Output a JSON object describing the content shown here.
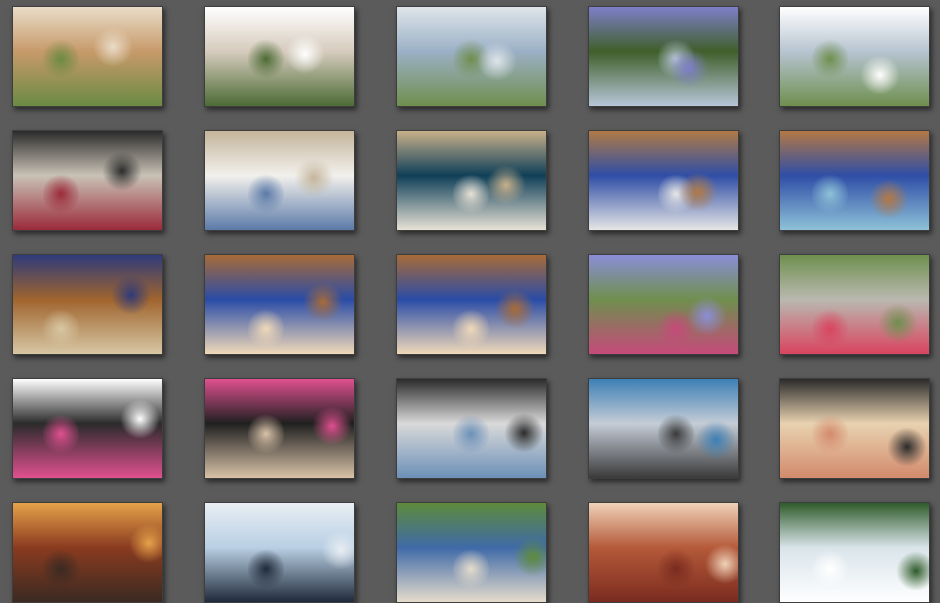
{
  "gallery": {
    "rows": [
      {
        "photos": [
          {
            "icon": "photo-icon",
            "palette": [
              "#c79a6a",
              "#e9dcc8",
              "#6b8a44"
            ]
          },
          {
            "icon": "photo-icon",
            "palette": [
              "#d6cbbd",
              "#ffffff",
              "#4c6b35"
            ]
          },
          {
            "icon": "photo-icon",
            "palette": [
              "#9bb0c6",
              "#dfe5ea",
              "#6f8f4e"
            ]
          },
          {
            "icon": "photo-icon",
            "palette": [
              "#3f5f2a",
              "#7e7fc9",
              "#b8c6d9"
            ]
          },
          {
            "icon": "photo-icon",
            "palette": [
              "#b7c4d1",
              "#ffffff",
              "#6f8f4e"
            ]
          }
        ]
      },
      {
        "photos": [
          {
            "icon": "photo-icon",
            "palette": [
              "#c9c2b6",
              "#2b2b2b",
              "#9b2a3a"
            ]
          },
          {
            "icon": "photo-icon",
            "palette": [
              "#f2f0ec",
              "#c4b59b",
              "#5b7aa8"
            ]
          },
          {
            "icon": "photo-icon",
            "palette": [
              "#0f3f58",
              "#c8b08a",
              "#e8e2d6"
            ]
          },
          {
            "icon": "photo-icon",
            "palette": [
              "#2f4ea6",
              "#b07a46",
              "#e6e6e6"
            ]
          },
          {
            "icon": "photo-icon",
            "palette": [
              "#2f4ea6",
              "#b37845",
              "#8ec2d8"
            ]
          }
        ]
      },
      {
        "photos": [
          {
            "icon": "photo-icon",
            "palette": [
              "#a0642e",
              "#2e3b7a",
              "#d7c7a4"
            ]
          },
          {
            "icon": "photo-icon",
            "palette": [
              "#2a4ca6",
              "#a86b38",
              "#f0d9b8"
            ]
          },
          {
            "icon": "photo-icon",
            "palette": [
              "#2a4ca6",
              "#a86b38",
              "#f0d9b8"
            ]
          },
          {
            "icon": "photo-icon",
            "palette": [
              "#6f8f4e",
              "#8b8ed6",
              "#c54a7a"
            ]
          },
          {
            "icon": "photo-icon",
            "palette": [
              "#b9b9b0",
              "#6f8f4e",
              "#d9445f"
            ]
          }
        ]
      },
      {
        "photos": [
          {
            "icon": "photo-icon",
            "palette": [
              "#2b2b2b",
              "#ffffff",
              "#e05090"
            ]
          },
          {
            "icon": "photo-icon",
            "palette": [
              "#202020",
              "#e05090",
              "#d8c2a8"
            ]
          },
          {
            "icon": "photo-icon",
            "palette": [
              "#d9d9d9",
              "#2b2b2b",
              "#6c90b8"
            ]
          },
          {
            "icon": "photo-icon",
            "palette": [
              "#c4ccd6",
              "#3d7fb5",
              "#3a3a3a"
            ]
          },
          {
            "icon": "photo-icon",
            "palette": [
              "#e8d2b0",
              "#2b2b2b",
              "#d38a6c"
            ]
          }
        ]
      },
      {
        "photos": [
          {
            "icon": "photo-icon",
            "palette": [
              "#8a3b1f",
              "#e6a24a",
              "#3a2a22"
            ]
          },
          {
            "icon": "photo-icon",
            "palette": [
              "#b9cfe4",
              "#e9eef3",
              "#1f2a3a"
            ]
          },
          {
            "icon": "photo-icon",
            "palette": [
              "#3f6aa8",
              "#5e8b3b",
              "#e6dccb"
            ]
          },
          {
            "icon": "photo-icon",
            "palette": [
              "#b55a3a",
              "#f0d2b8",
              "#7a2b1f"
            ]
          },
          {
            "icon": "photo-icon",
            "palette": [
              "#d9e4ea",
              "#2f5b2a",
              "#ffffff"
            ]
          }
        ]
      }
    ]
  }
}
